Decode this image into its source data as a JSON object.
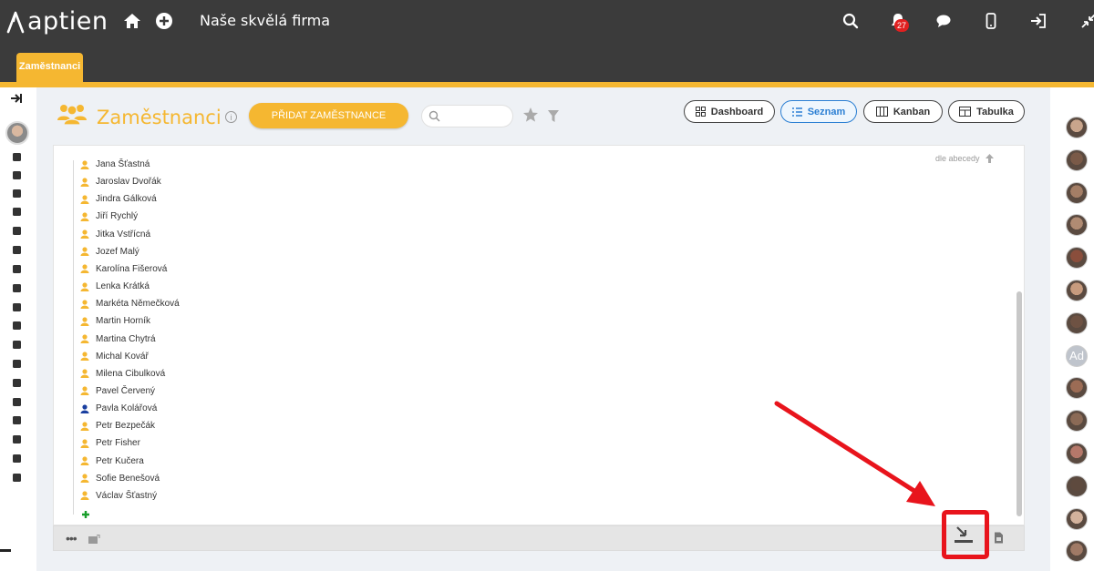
{
  "app": {
    "logo_text": "aptien",
    "company": "Naše skvělá firma",
    "notifications_count": "27"
  },
  "module_tab": "Zaměstnanci",
  "page": {
    "title": "Zaměstnanci",
    "add_button": "PŘIDAT ZAMĚSTNANCE",
    "search_placeholder": "",
    "sort_label": "dle abecedy"
  },
  "views": [
    {
      "label": "Dashboard",
      "icon": "grid-icon",
      "active": false
    },
    {
      "label": "Seznam",
      "icon": "list-icon",
      "active": true
    },
    {
      "label": "Kanban",
      "icon": "kanban-icon",
      "active": false
    },
    {
      "label": "Tabulka",
      "icon": "table-icon",
      "active": false
    }
  ],
  "employees": [
    {
      "name": "Jana Šťastná",
      "color": "#f5b731"
    },
    {
      "name": "Jaroslav Dvořák",
      "color": "#f5b731"
    },
    {
      "name": "Jindra Gálková",
      "color": "#f5b731"
    },
    {
      "name": "Jiří Rychlý",
      "color": "#f5b731"
    },
    {
      "name": "Jitka Vstřícná",
      "color": "#f5b731"
    },
    {
      "name": "Jozef Malý",
      "color": "#f5b731"
    },
    {
      "name": "Karolína Fišerová",
      "color": "#f5b731"
    },
    {
      "name": "Lenka Krátká",
      "color": "#f5b731"
    },
    {
      "name": "Markéta Němečková",
      "color": "#f5b731"
    },
    {
      "name": "Martin Horník",
      "color": "#f5b731"
    },
    {
      "name": "Martina Chytrá",
      "color": "#f5b731"
    },
    {
      "name": "Michal Kovář",
      "color": "#f5b731"
    },
    {
      "name": "Milena Cibulková",
      "color": "#f5b731"
    },
    {
      "name": "Pavel Červený",
      "color": "#f5b731"
    },
    {
      "name": "Pavla Kolářová",
      "color": "#1a3fa0"
    },
    {
      "name": "Petr Bezpečák",
      "color": "#f5b731"
    },
    {
      "name": "Petr Fisher",
      "color": "#f5b731"
    },
    {
      "name": "Petr Kučera",
      "color": "#f5b731"
    },
    {
      "name": "Sofie Benešová",
      "color": "#f5b731"
    },
    {
      "name": "Václav Šťastný",
      "color": "#f5b731"
    }
  ],
  "right_avatars": [
    {
      "type": "photo",
      "color": "#c9a58c"
    },
    {
      "type": "photo",
      "color": "#7a5a48"
    },
    {
      "type": "photo",
      "color": "#a47e66"
    },
    {
      "type": "photo",
      "color": "#b08b73"
    },
    {
      "type": "photo",
      "color": "#8a4e3c"
    },
    {
      "type": "photo",
      "color": "#c79b7e"
    },
    {
      "type": "photo",
      "color": "#6e5243"
    },
    {
      "type": "initials",
      "text": "Ad"
    },
    {
      "type": "photo",
      "color": "#9c6c55"
    },
    {
      "type": "photo",
      "color": "#8b6a56"
    },
    {
      "type": "photo",
      "color": "#b5786a"
    },
    {
      "type": "photo",
      "color": "#5e4a3e"
    },
    {
      "type": "photo",
      "color": "#d3b29c"
    },
    {
      "type": "photo",
      "color": "#a07a66"
    }
  ],
  "colors": {
    "accent": "#f5b731",
    "topbar": "#3b3b3b",
    "active_view": "#2b7fd3",
    "annotation": "#e8141c"
  }
}
